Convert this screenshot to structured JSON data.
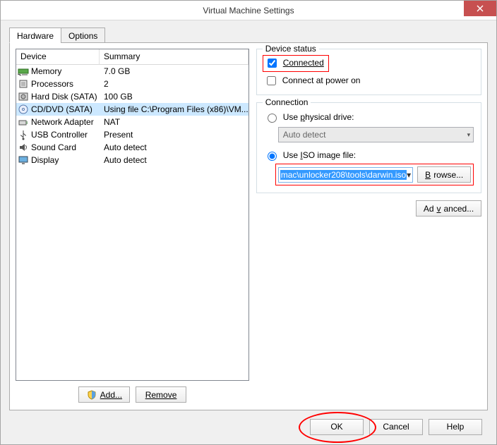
{
  "window": {
    "title": "Virtual Machine Settings"
  },
  "tabs": {
    "hardware": "Hardware",
    "options": "Options"
  },
  "list": {
    "header_device": "Device",
    "header_summary": "Summary",
    "rows": [
      {
        "name": "Memory",
        "summary": "7.0 GB",
        "icon": "memory"
      },
      {
        "name": "Processors",
        "summary": "2",
        "icon": "cpu"
      },
      {
        "name": "Hard Disk (SATA)",
        "summary": "100 GB",
        "icon": "hdd"
      },
      {
        "name": "CD/DVD (SATA)",
        "summary": "Using file C:\\Program Files (x86)\\VM...",
        "icon": "cd",
        "selected": true
      },
      {
        "name": "Network Adapter",
        "summary": "NAT",
        "icon": "net"
      },
      {
        "name": "USB Controller",
        "summary": "Present",
        "icon": "usb"
      },
      {
        "name": "Sound Card",
        "summary": "Auto detect",
        "icon": "sound"
      },
      {
        "name": "Display",
        "summary": "Auto detect",
        "icon": "display"
      }
    ]
  },
  "leftbtns": {
    "add": "Add...",
    "remove": "Remove"
  },
  "device_status": {
    "group": "Device status",
    "connected": "Connected",
    "power_on": "Connect at power on"
  },
  "connection": {
    "group": "Connection",
    "physical_pre": "Use ",
    "physical_u": "p",
    "physical_post": "hysical drive:",
    "physical_combo": "Auto detect",
    "iso_pre": "Use ",
    "iso_u": "I",
    "iso_post": "SO image file:",
    "iso_value": "mac\\unlocker208\\tools\\darwin.iso",
    "browse_u": "B",
    "browse_rest": "rowse..."
  },
  "advanced": {
    "label_pre": "Ad",
    "label_u": "v",
    "label_post": "anced..."
  },
  "bottom": {
    "ok": "OK",
    "cancel": "Cancel",
    "help": "Help"
  }
}
